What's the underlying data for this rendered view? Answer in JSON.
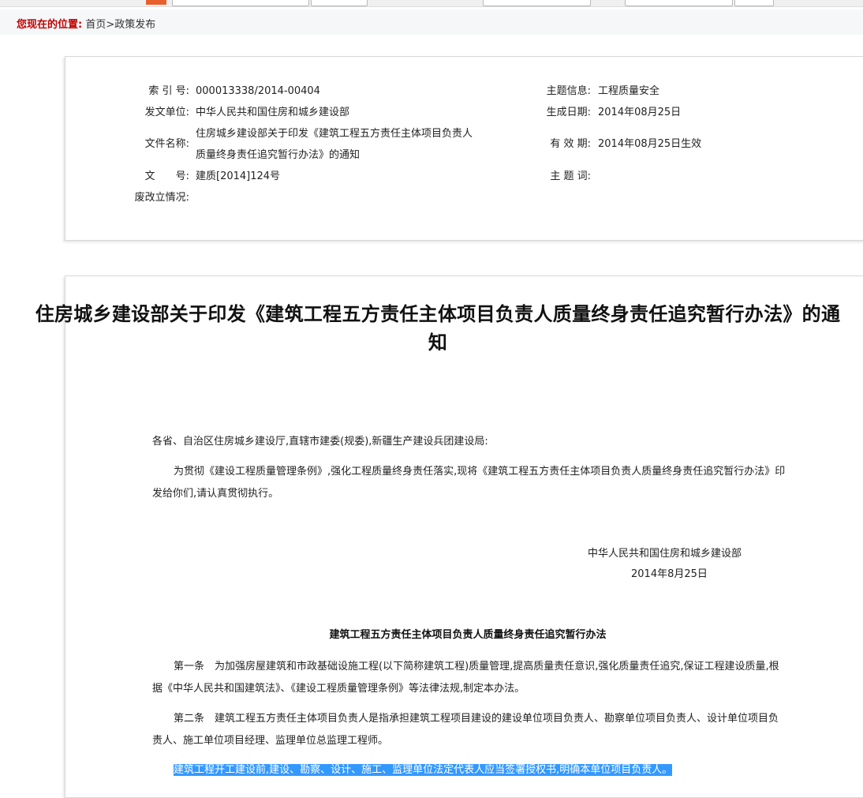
{
  "breadcrumb": {
    "label": "您现在的位置:",
    "path": "首页>政策发布"
  },
  "info": {
    "index_label": "索 引 号:",
    "index_value": "000013338/2014-00404",
    "topic_label": "主题信息:",
    "topic_value": "工程质量安全",
    "issuer_label": "发文单位:",
    "issuer_value": "中华人民共和国住房和城乡建设部",
    "date_label": "生成日期:",
    "date_value": "2014年08月25日",
    "filename_label": "文件名称:",
    "filename_value": "住房城乡建设部关于印发《建筑工程五方责任主体项目负责人质量终身责任追究暂行办法》的通知",
    "validity_label": "有 效 期:",
    "validity_value": "2014年08月25日生效",
    "docno_label": "文　　号:",
    "docno_value": "建质[2014]124号",
    "keywords_label": "主 题 词:",
    "keywords_value": "",
    "status_label": "废改立情况:",
    "status_value": ""
  },
  "article": {
    "title": "住房城乡建设部关于印发《建筑工程五方责任主体项目负责人质量终身责任追究暂行办法》的通知",
    "salutation": "各省、自治区住房城乡建设厅,直辖市建委(规委),新疆生产建设兵团建设局:",
    "intro": "为贯彻《建设工程质量管理条例》,强化工程质量终身责任落实,现将《建筑工程五方责任主体项目负责人质量终身责任追究暂行办法》印发给你们,请认真贯彻执行。",
    "signature_org": "中华人民共和国住房和城乡建设部",
    "signature_date": "2014年8月25日",
    "measure_title": "建筑工程五方责任主体项目负责人质量终身责任追究暂行办法",
    "article1": "第一条　为加强房屋建筑和市政基础设施工程(以下简称建筑工程)质量管理,提高质量责任意识,强化质量责任追究,保证工程建设质量,根据《中华人民共和国建筑法》、《建设工程质量管理条例》等法律法规,制定本办法。",
    "article2": "第二条　建筑工程五方责任主体项目负责人是指承担建筑工程项目建设的建设单位项目负责人、勘察单位项目负责人、设计单位项目负责人、施工单位项目经理、监理单位总监理工程师。",
    "highlighted": "建筑工程开工建设前,建设、勘察、设计、施工、监理单位法定代表人应当签署授权书,明确本单位项目负责人。"
  },
  "colors": {
    "breadcrumb_label": "#c00000",
    "selection_highlight": "#3399ff"
  }
}
